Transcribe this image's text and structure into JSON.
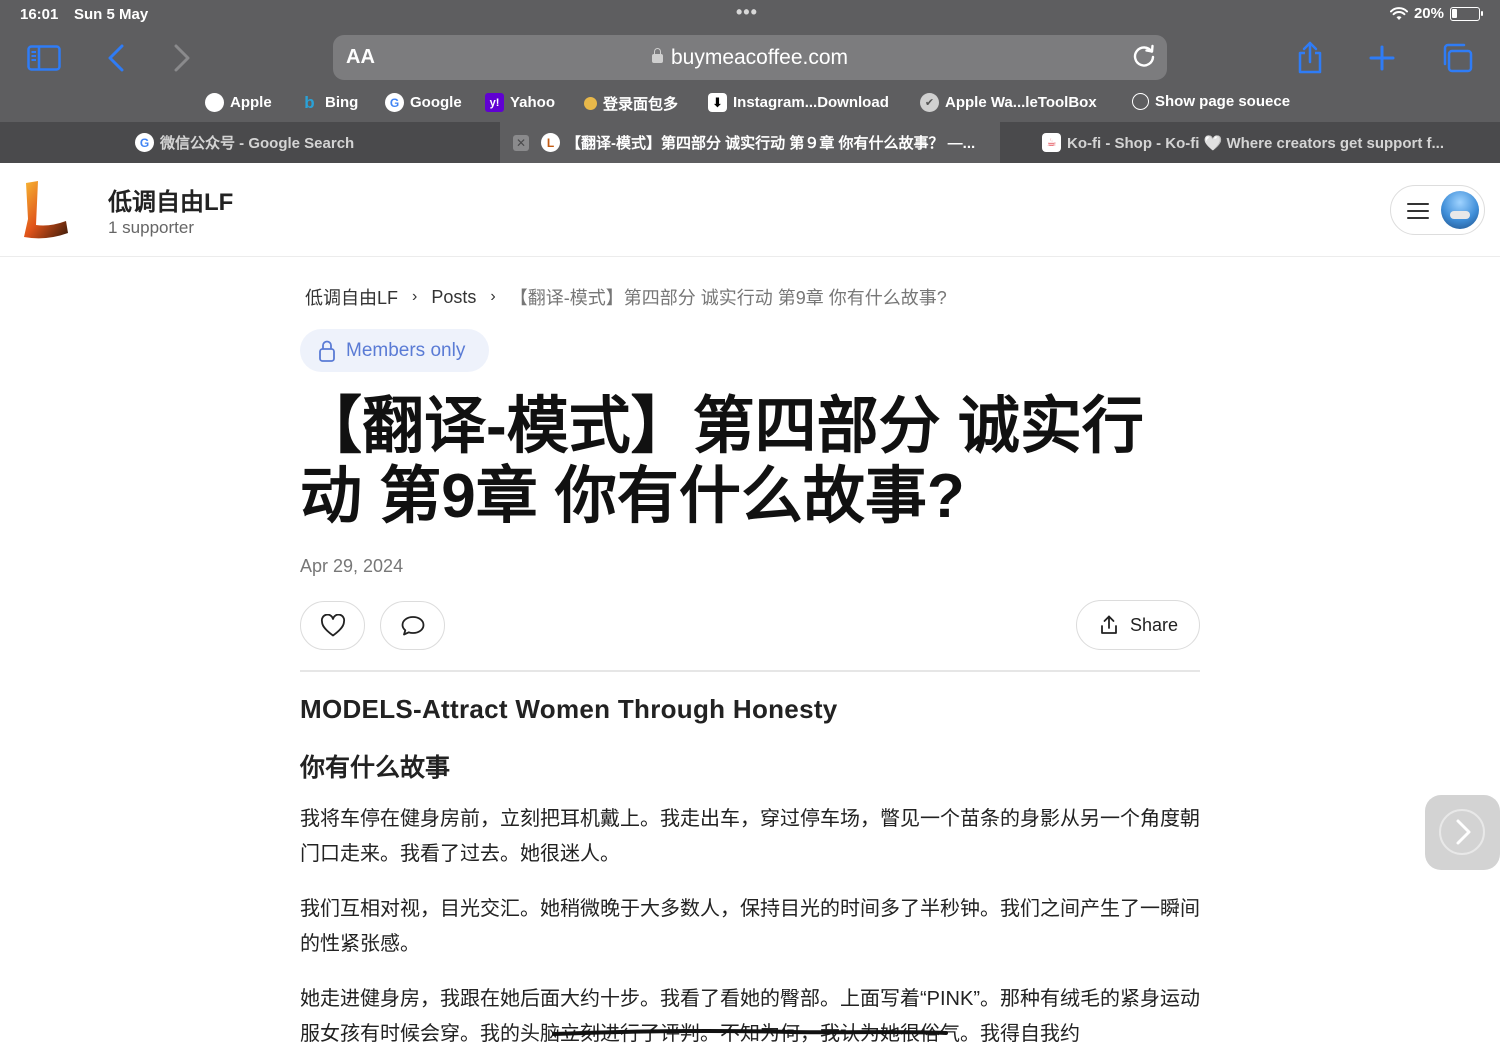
{
  "status_bar": {
    "time": "16:01",
    "date": "Sun 5 May",
    "battery": "20%",
    "battery_level": 0.2
  },
  "browser": {
    "url": "buymeacoffee.com",
    "aa_label": "AA",
    "bookmarks": [
      {
        "label": "Apple",
        "icon": "apple-icon"
      },
      {
        "label": "Bing",
        "icon": "bing-icon"
      },
      {
        "label": "Google",
        "icon": "google-icon"
      },
      {
        "label": "Yahoo",
        "icon": "yahoo-icon"
      },
      {
        "label": "登录面包多",
        "icon": "mianbaoduo-icon"
      },
      {
        "label": "Instagram...Download",
        "icon": "download-icon"
      },
      {
        "label": "Apple Wa...leToolBox",
        "icon": "toolbox-icon"
      },
      {
        "label": "Show page souece",
        "icon": "globe-icon"
      }
    ],
    "tabs": [
      {
        "title": "微信公众号 - Google Search",
        "active": false
      },
      {
        "title": "【翻译-模式】第四部分 诚实行动 第９章 你有什么故事？ —...",
        "active": true
      },
      {
        "title": "Ko-fi - Shop - Ko-fi 🤍 Where creators get support f...",
        "active": false
      }
    ]
  },
  "creator": {
    "name": "低调自由LF",
    "supporters": "1 supporter"
  },
  "breadcrumb": {
    "home": "低调自由LF",
    "section": "Posts",
    "current": "【翻译-模式】第四部分 诚实行动 第9章 你有什么故事?"
  },
  "post": {
    "badge": "Members only",
    "title": "【翻译-模式】第四部分 诚实行动 第9章 你有什么故事?",
    "date": "Apr 29, 2024",
    "share_label": "Share",
    "subheading": "MODELS-Attract Women Through Honesty",
    "section_heading": "你有什么故事",
    "paragraphs": [
      "我将车停在健身房前，立刻把耳机戴上。我走出车，穿过停车场，瞥见一个苗条的身影从另一个角度朝门口走来。我看了过去。她很迷人。",
      "我们互相对视，目光交汇。她稍微晚于大多数人，保持目光的时间多了半秒钟。我们之间产生了一瞬间的性紧张感。",
      "她走进健身房，我跟在她后面大约十步。我看了看她的臀部。上面写着“PINK”。那种有绒毛的紧身运动服女孩有时候会穿。我的头脑立刻进行了评判。不知为何，我认为她很俗气。我得自我约"
    ]
  },
  "colors": {
    "chrome": "#5e5e60",
    "badge_text": "#5a7bd5",
    "badge_bg": "#eef2fb"
  }
}
